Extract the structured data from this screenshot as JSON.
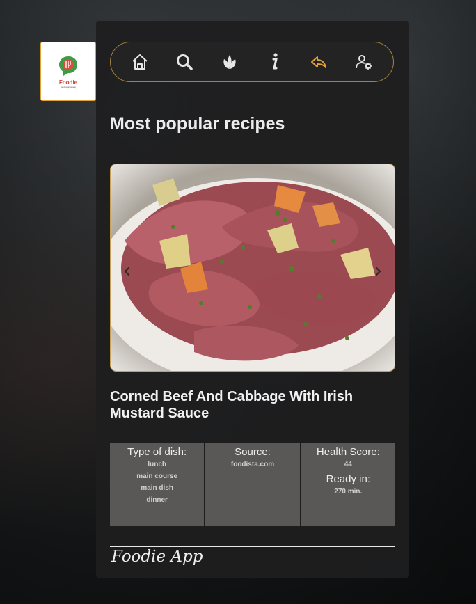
{
  "logo": {
    "name": "Foodie",
    "tagline": "food recipes app"
  },
  "nav": {
    "items": [
      {
        "icon": "home-icon"
      },
      {
        "icon": "search-icon"
      },
      {
        "icon": "leaf-icon"
      },
      {
        "icon": "info-icon"
      },
      {
        "icon": "back-arrow-icon",
        "active": true
      },
      {
        "icon": "user-settings-icon"
      }
    ]
  },
  "page": {
    "title": "Most popular recipes"
  },
  "recipe": {
    "name": "Corned Beef And Cabbage With Irish Mustard Sauce",
    "type_label": "Type of dish:",
    "types": [
      "lunch",
      "main course",
      "main dish",
      "dinner"
    ],
    "source_label": "Source:",
    "source": "foodista.com",
    "health_label": "Health Score:",
    "health_score": "44",
    "ready_label": "Ready in:",
    "ready_in": "270 min."
  },
  "footer": {
    "brand": "Foodie App"
  },
  "colors": {
    "accent": "#e4a13a",
    "panel": "#1e1e1f",
    "cell": "#5a5757"
  }
}
